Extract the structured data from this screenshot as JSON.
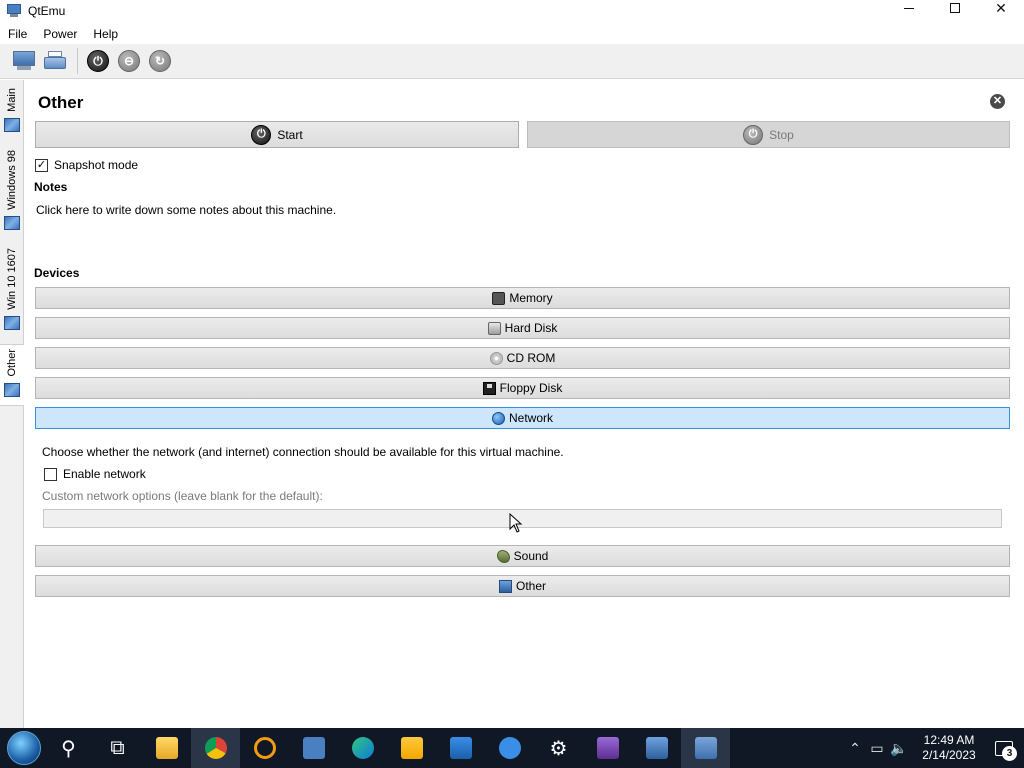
{
  "window": {
    "title": "QtEmu"
  },
  "menu": [
    "File",
    "Power",
    "Help"
  ],
  "sidebar": {
    "tabs": [
      {
        "label": "Main",
        "active": false
      },
      {
        "label": "Windows 98",
        "active": false
      },
      {
        "label": "Win 10 1607",
        "active": false
      },
      {
        "label": "Other",
        "active": true
      }
    ]
  },
  "machine": {
    "name": "Other",
    "start_label": "Start",
    "stop_label": "Stop",
    "snapshot_label": "Snapshot mode",
    "snapshot_checked": true,
    "notes_heading": "Notes",
    "notes_placeholder": "Click here to write down some notes about this machine.",
    "devices_heading": "Devices"
  },
  "devices": [
    {
      "label": "Memory",
      "icon": "memory-icon"
    },
    {
      "label": "Hard Disk",
      "icon": "hard-disk-icon"
    },
    {
      "label": "CD ROM",
      "icon": "cd-rom-icon"
    },
    {
      "label": "Floppy Disk",
      "icon": "floppy-disk-icon"
    },
    {
      "label": "Network",
      "icon": "network-icon",
      "selected": true
    },
    {
      "label": "Sound",
      "icon": "sound-icon"
    },
    {
      "label": "Other",
      "icon": "other-device-icon"
    }
  ],
  "network": {
    "description": "Choose whether the network (and internet) connection should be available for this virtual machine.",
    "enable_label": "Enable network",
    "enabled": false,
    "custom_hint": "Custom network options (leave blank for the default):",
    "custom_value": ""
  },
  "taskbar": {
    "clock_time": "12:49 AM",
    "clock_date": "2/14/2023",
    "notification_count": "3"
  },
  "colors": {
    "selected_bg": "#cde6fb",
    "selected_border": "#3c8fdb",
    "taskbar_bg": "#101826"
  }
}
